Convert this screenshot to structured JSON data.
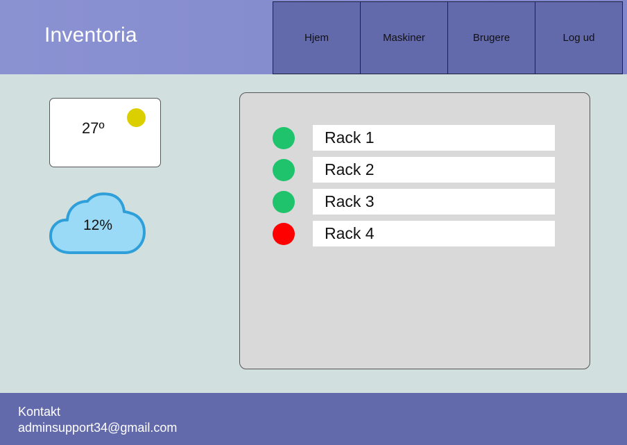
{
  "header": {
    "brand": "Inventoria",
    "nav": [
      {
        "label": "Hjem"
      },
      {
        "label": "Maskiner"
      },
      {
        "label": "Brugere"
      },
      {
        "label": "Log ud"
      }
    ]
  },
  "weather": {
    "temperature": "27º",
    "precipitation": "12%",
    "sun_icon": "sun-icon",
    "cloud_icon": "cloud-icon"
  },
  "racks": [
    {
      "label": "Rack 1",
      "status": "ok"
    },
    {
      "label": "Rack 2",
      "status": "ok"
    },
    {
      "label": "Rack 3",
      "status": "ok"
    },
    {
      "label": "Rack 4",
      "status": "error"
    }
  ],
  "footer": {
    "contact_label": "Kontakt",
    "email": "adminsupport34@gmail.com"
  },
  "colors": {
    "header_bg": "#8289cd",
    "nav_bg": "#636aac",
    "footer_bg": "#636aac",
    "page_bg": "#d1dfdf",
    "panel_bg": "#d9d9d9",
    "status_ok": "#1ec36c",
    "status_error": "#ff0000",
    "sun": "#dccf00",
    "cloud_fill": "#9bdaf7",
    "cloud_stroke": "#2e9fd8"
  }
}
